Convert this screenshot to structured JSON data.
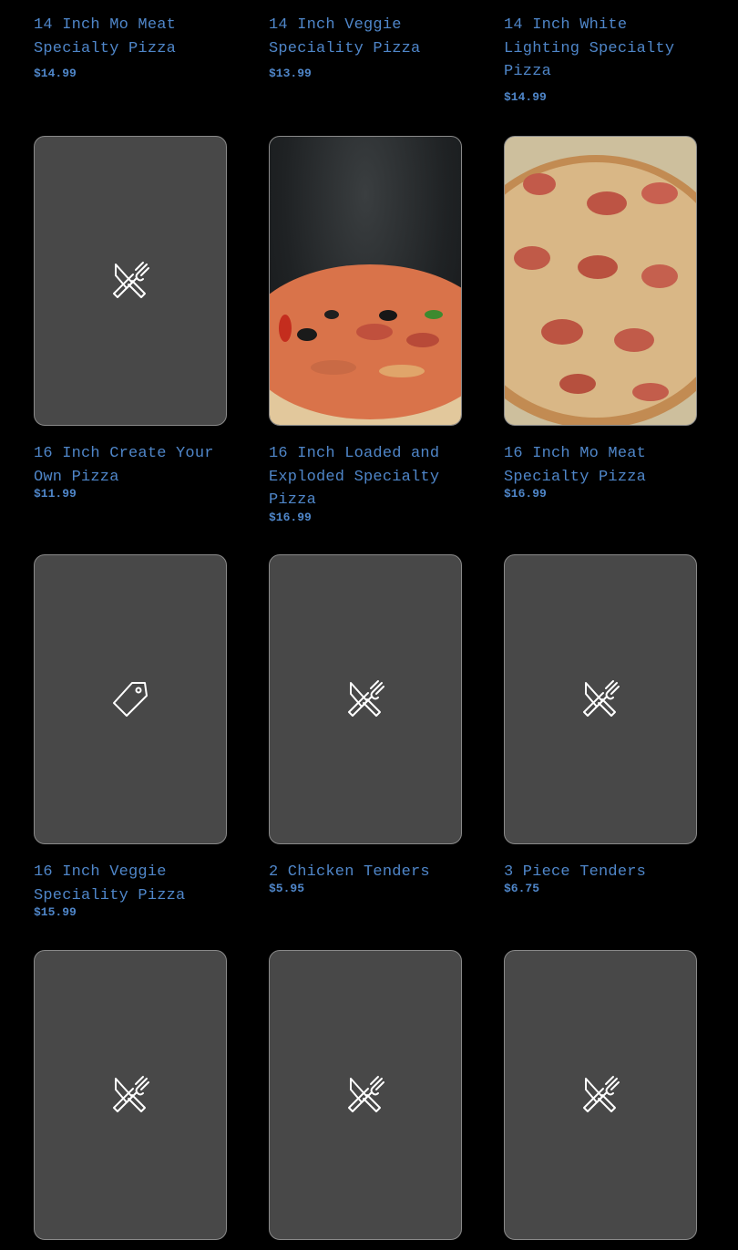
{
  "top_row": [
    {
      "name": "14 Inch Mo Meat Specialty Pizza",
      "price": "$14.99"
    },
    {
      "name": "14 Inch Veggie Speciality Pizza",
      "price": "$13.99"
    },
    {
      "name": "14 Inch White Lighting Specialty Pizza",
      "price": "$14.99"
    }
  ],
  "items": [
    {
      "name": "16 Inch Create Your Own Pizza",
      "price": "$11.99",
      "thumb": "utensils-icon"
    },
    {
      "name": "16 Inch Loaded and Exploded Specialty Pizza",
      "price": "$16.99",
      "thumb": "pizza-photo"
    },
    {
      "name": "16 Inch Mo Meat Specialty Pizza",
      "price": "$16.99",
      "thumb": "pizza-photo"
    },
    {
      "name": "16 Inch Veggie Speciality Pizza",
      "price": "$15.99",
      "thumb": "tag-icon"
    },
    {
      "name": "2 Chicken Tenders",
      "price": "$5.95",
      "thumb": "utensils-icon"
    },
    {
      "name": "3 Piece Tenders",
      "price": "$6.75",
      "thumb": "utensils-icon"
    },
    {
      "thumb": "utensils-icon"
    },
    {
      "thumb": "utensils-icon"
    },
    {
      "thumb": "utensils-icon"
    }
  ],
  "colors": {
    "background": "#000000",
    "text_accent": "#4f86c9",
    "placeholder": "#484848"
  }
}
